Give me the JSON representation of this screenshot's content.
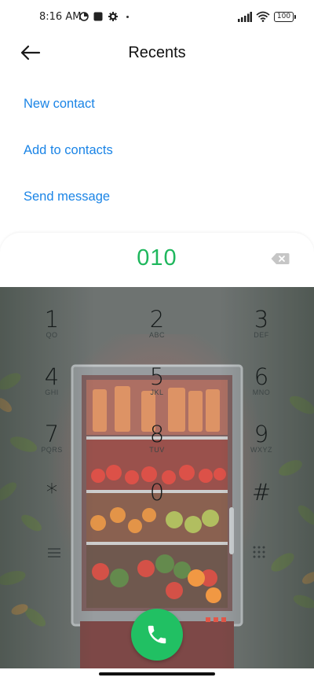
{
  "status": {
    "time": "8:16 AM",
    "battery": "100",
    "icons": [
      "timer-icon",
      "square-notification-icon",
      "settings-icon",
      "signal-icon",
      "wifi-icon",
      "battery-icon"
    ]
  },
  "header": {
    "title": "Recents"
  },
  "actions": [
    {
      "label": "New contact"
    },
    {
      "label": "Add to contacts"
    },
    {
      "label": "Send message"
    }
  ],
  "dialer": {
    "number": "010"
  },
  "keys": [
    {
      "digit": "1",
      "letters": "QO"
    },
    {
      "digit": "2",
      "letters": "ABC"
    },
    {
      "digit": "3",
      "letters": "DEF"
    },
    {
      "digit": "4",
      "letters": "GHI"
    },
    {
      "digit": "5",
      "letters": "JKL"
    },
    {
      "digit": "6",
      "letters": "MNO"
    },
    {
      "digit": "7",
      "letters": "PQRS"
    },
    {
      "digit": "8",
      "letters": "TUV"
    },
    {
      "digit": "9",
      "letters": "WXYZ"
    },
    {
      "digit": "*",
      "letters": ""
    },
    {
      "digit": "0",
      "letters": ""
    },
    {
      "digit": "#",
      "letters": ""
    }
  ],
  "colors": {
    "accent_link": "#1a84e6",
    "number": "#1fb75d",
    "call": "#21c063"
  }
}
